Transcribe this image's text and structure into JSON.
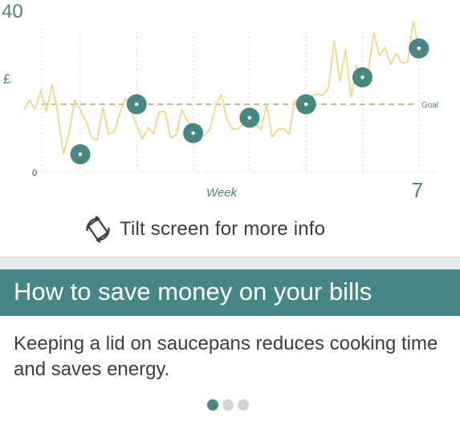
{
  "colors": {
    "accent": "#468783",
    "line": "#f2d68a",
    "goal_line": "#b08a4a",
    "text": "#3d3d3d"
  },
  "chart_data": {
    "type": "line",
    "y_max_label": "40",
    "y_min_label": "0",
    "y_axis_label": "£",
    "x_axis_label": "Week",
    "x_end_label": "7",
    "goal_label": "Goal",
    "ylim": [
      0,
      40
    ],
    "goal_value": 17.5,
    "grid": "dotted vertical at each week",
    "series": [
      {
        "values": [
          [
            0,
            16
          ],
          [
            0.1,
            18.6
          ],
          [
            0.2,
            16.2
          ],
          [
            0.3,
            21
          ],
          [
            0.4,
            15.6
          ],
          [
            0.5,
            22.6
          ],
          [
            0.6,
            15.4
          ],
          [
            0.7,
            4.5
          ],
          [
            0.8,
            10
          ],
          [
            0.9,
            18.6
          ],
          [
            1,
            16
          ],
          [
            1.1,
            13.2
          ],
          [
            1.2,
            8.8
          ],
          [
            1.3,
            8.2
          ],
          [
            1.4,
            16.7
          ],
          [
            1.5,
            9.8
          ],
          [
            1.6,
            10.3
          ],
          [
            1.7,
            15.2
          ],
          [
            1.8,
            19
          ],
          [
            1.9,
            15.8
          ],
          [
            2,
            12
          ],
          [
            2.1,
            8.5
          ],
          [
            2.2,
            11.4
          ],
          [
            2.3,
            9.9
          ],
          [
            2.4,
            15.5
          ],
          [
            2.5,
            15.7
          ],
          [
            2.6,
            8.8
          ],
          [
            2.7,
            9.6
          ],
          [
            2.8,
            16
          ],
          [
            2.9,
            13.1
          ],
          [
            3,
            12
          ],
          [
            3.1,
            10.1
          ],
          [
            3.2,
            9.2
          ],
          [
            3.3,
            11.2
          ],
          [
            3.4,
            17.2
          ],
          [
            3.5,
            20.1
          ],
          [
            3.6,
            13.5
          ],
          [
            3.7,
            11
          ],
          [
            3.8,
            11.2
          ],
          [
            3.9,
            12.6
          ],
          [
            4,
            13
          ],
          [
            4.1,
            12.8
          ],
          [
            4.2,
            10.9
          ],
          [
            4.3,
            17.6
          ],
          [
            4.4,
            8.9
          ],
          [
            4.5,
            10.9
          ],
          [
            4.6,
            11.2
          ],
          [
            4.7,
            9.6
          ],
          [
            4.8,
            18.5
          ],
          [
            4.9,
            16.8
          ],
          [
            5,
            18
          ],
          [
            5.1,
            19.6
          ],
          [
            5.2,
            20.2
          ],
          [
            5.3,
            19.8
          ],
          [
            5.4,
            21.7
          ],
          [
            5.5,
            34
          ],
          [
            5.6,
            23.4
          ],
          [
            5.7,
            31.5
          ],
          [
            5.8,
            19.3
          ],
          [
            5.9,
            27.6
          ],
          [
            6,
            22
          ],
          [
            6.1,
            26.1
          ],
          [
            6.2,
            36
          ],
          [
            6.3,
            30.1
          ],
          [
            6.4,
            32.3
          ],
          [
            6.5,
            27.8
          ],
          [
            6.6,
            30.7
          ],
          [
            6.7,
            28.2
          ],
          [
            6.8,
            28.5
          ],
          [
            6.9,
            39
          ],
          [
            7,
            32
          ]
        ]
      }
    ],
    "markers": [
      {
        "week": 1,
        "value": 4.5
      },
      {
        "week": 2,
        "value": 17.5
      },
      {
        "week": 3,
        "value": 10
      },
      {
        "week": 4,
        "value": 14
      },
      {
        "week": 5,
        "value": 17.5
      },
      {
        "week": 6,
        "value": 24.5
      },
      {
        "week": 7,
        "value": 32
      }
    ]
  },
  "tilt": {
    "text": "Tilt screen for more info",
    "icon": "rotate-device-icon"
  },
  "banner": {
    "title": "How to save money on your bills"
  },
  "tip": {
    "text": "Keeping a lid on saucepans reduces cooking time and saves energy."
  },
  "pager": {
    "count": 3,
    "active_index": 0
  }
}
